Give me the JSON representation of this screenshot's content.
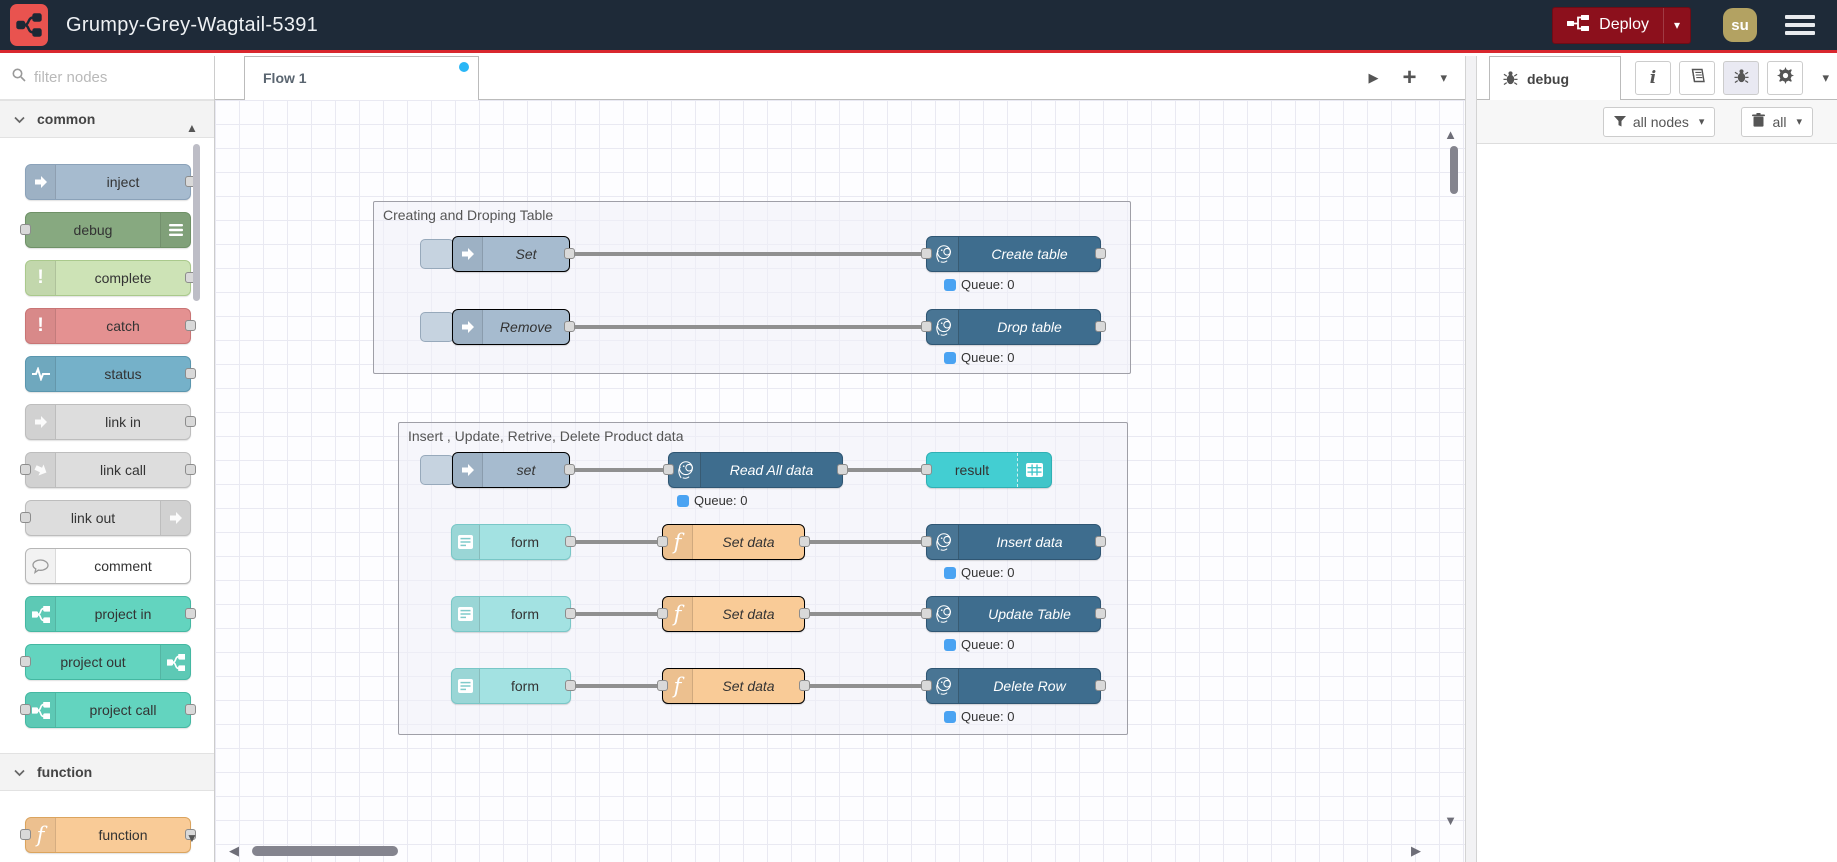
{
  "header": {
    "title": "Grumpy-Grey-Wagtail-5391",
    "deploy_label": "Deploy",
    "avatar_initials": "su"
  },
  "palette": {
    "filter_placeholder": "filter nodes",
    "categories": [
      {
        "label": "common",
        "nodes": [
          {
            "label": "inject"
          },
          {
            "label": "debug"
          },
          {
            "label": "complete"
          },
          {
            "label": "catch"
          },
          {
            "label": "status"
          },
          {
            "label": "link in"
          },
          {
            "label": "link call"
          },
          {
            "label": "link out"
          },
          {
            "label": "comment"
          },
          {
            "label": "project in"
          },
          {
            "label": "project out"
          },
          {
            "label": "project call"
          }
        ]
      },
      {
        "label": "function",
        "nodes": [
          {
            "label": "function"
          }
        ]
      }
    ]
  },
  "workspace": {
    "active_tab": "Flow 1"
  },
  "flow": {
    "queue_label": "Queue: 0",
    "groups": [
      {
        "title": "Creating and Droping Table",
        "rows": [
          {
            "inject": "Set",
            "db": "Create table"
          },
          {
            "inject": "Remove",
            "db": "Drop table"
          }
        ]
      },
      {
        "title": "Insert , Update, Retrive, Delete Product data",
        "read_row": {
          "inject": "set",
          "db": "Read All data",
          "result": "result"
        },
        "form_rows": [
          {
            "form": "form",
            "func": "Set data",
            "db": "Insert data"
          },
          {
            "form": "form",
            "func": "Set data",
            "db": "Update Table"
          },
          {
            "form": "form",
            "func": "Set data",
            "db": "Delete Row"
          }
        ]
      }
    ]
  },
  "debug_sidebar": {
    "tab_label": "debug",
    "filter_button": "all nodes",
    "clear_button": "all"
  },
  "icons": {
    "exclaim": "!",
    "function_f": "f",
    "info_i": "i",
    "plus": "+",
    "chevron_down": "▾",
    "play": "▶",
    "scroll_up": "▲",
    "scroll_down": "▼",
    "scroll_left": "◀",
    "scroll_right": "▶"
  },
  "colors": {
    "header_bg": "#1e2a38",
    "header_accent": "#d9272e",
    "logo_red": "#e9534f",
    "deploy_bg": "#8c101c",
    "avatar_bg": "#b3a262",
    "tab_modified_dot": "#29b6f6",
    "queue_badge": "#4aa3f2",
    "node_inject": "#a6bbcf",
    "node_debug": "#87a980",
    "node_complete": "#cde3b6",
    "node_catch": "#e49191",
    "node_status": "#75b1c9",
    "node_link": "#dddddd",
    "node_project": "#63d4bf",
    "node_function": "#f9cb97",
    "node_postgresql": "#3e6d8e",
    "node_result": "#43ced2",
    "node_form": "#a3e2e2"
  }
}
